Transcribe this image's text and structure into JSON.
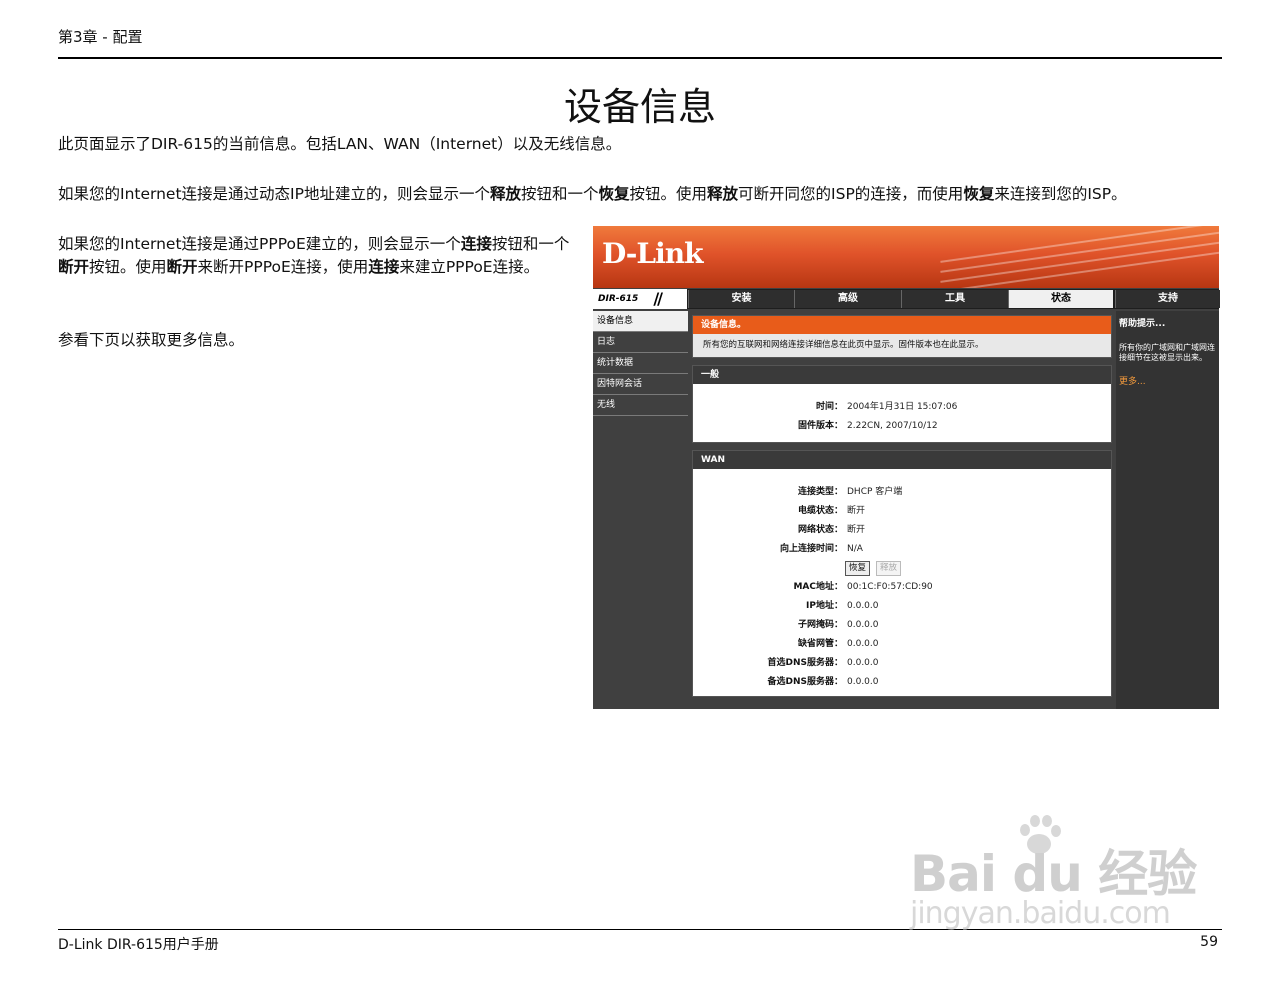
{
  "header": {
    "chapter": "第3章 - 配置"
  },
  "title": "设备信息",
  "paragraphs": {
    "p1": "此页面显示了DIR-615的当前信息。包括LAN、WAN（Internet）以及无线信息。",
    "p2": [
      "如果您的Internet连接是通过动态IP地址建立的，则会显示一个",
      "释放",
      "按钮和一个",
      "恢复",
      "按钮。使用",
      "释放",
      "可断开同您的ISP的连接，而使用",
      "恢复",
      "来连接到您的ISP。"
    ],
    "p3": [
      "如果您的Internet连接是通过PPPoE建立的，则会显示一个",
      "连接",
      "按钮和一个",
      "断开",
      "按钮。使用",
      "断开",
      "来断开PPPoE连接，使用",
      "连接",
      "来建立PPPoE连接。"
    ],
    "p4": "参看下页以获取更多信息。"
  },
  "router": {
    "logo": "D-Link",
    "model": "DIR-615",
    "tabs": [
      "安装",
      "高级",
      "工具",
      "状态",
      "支持"
    ],
    "active_tab": "状态",
    "sidebar": [
      "设备信息",
      "日志",
      "统计数据",
      "因特网会话",
      "无线"
    ],
    "device_info": {
      "title": "设备信息。",
      "note": "所有您的互联网和网络连接详细信息在此页中显示。固件版本也在此显示。"
    },
    "general": {
      "title": "一般",
      "rows": [
        {
          "k": "时间：",
          "v": "2004年1月31日 15:07:06"
        },
        {
          "k": "固件版本：",
          "v": "2.22CN, 2007/10/12"
        }
      ]
    },
    "wan": {
      "title": "WAN",
      "rows_top": [
        {
          "k": "连接类型：",
          "v": "DHCP 客户端"
        },
        {
          "k": "电缆状态：",
          "v": "断开"
        },
        {
          "k": "网络状态：",
          "v": "断开"
        },
        {
          "k": "向上连接时间：",
          "v": "N/A"
        }
      ],
      "renew_label": "恢复",
      "release_label": "释放",
      "rows_bottom": [
        {
          "k": "MAC地址：",
          "v": "00:1C:F0:57:CD:90"
        },
        {
          "k": "IP地址：",
          "v": "0.0.0.0"
        },
        {
          "k": "子网掩码：",
          "v": "0.0.0.0"
        },
        {
          "k": "缺省网管：",
          "v": "0.0.0.0"
        },
        {
          "k": "首选DNS服务器：",
          "v": "0.0.0.0"
        },
        {
          "k": "备选DNS服务器：",
          "v": "0.0.0.0"
        }
      ]
    },
    "help": {
      "title": "帮助提示...",
      "body": "所有你的广域网和广域网连接细节在这被显示出来。",
      "more": "更多..."
    }
  },
  "footer": {
    "manual": "D-Link DIR-615用户手册",
    "page": "59"
  },
  "watermark": {
    "brand": "Bai du 经验",
    "url": "jingyan.baidu.com"
  }
}
